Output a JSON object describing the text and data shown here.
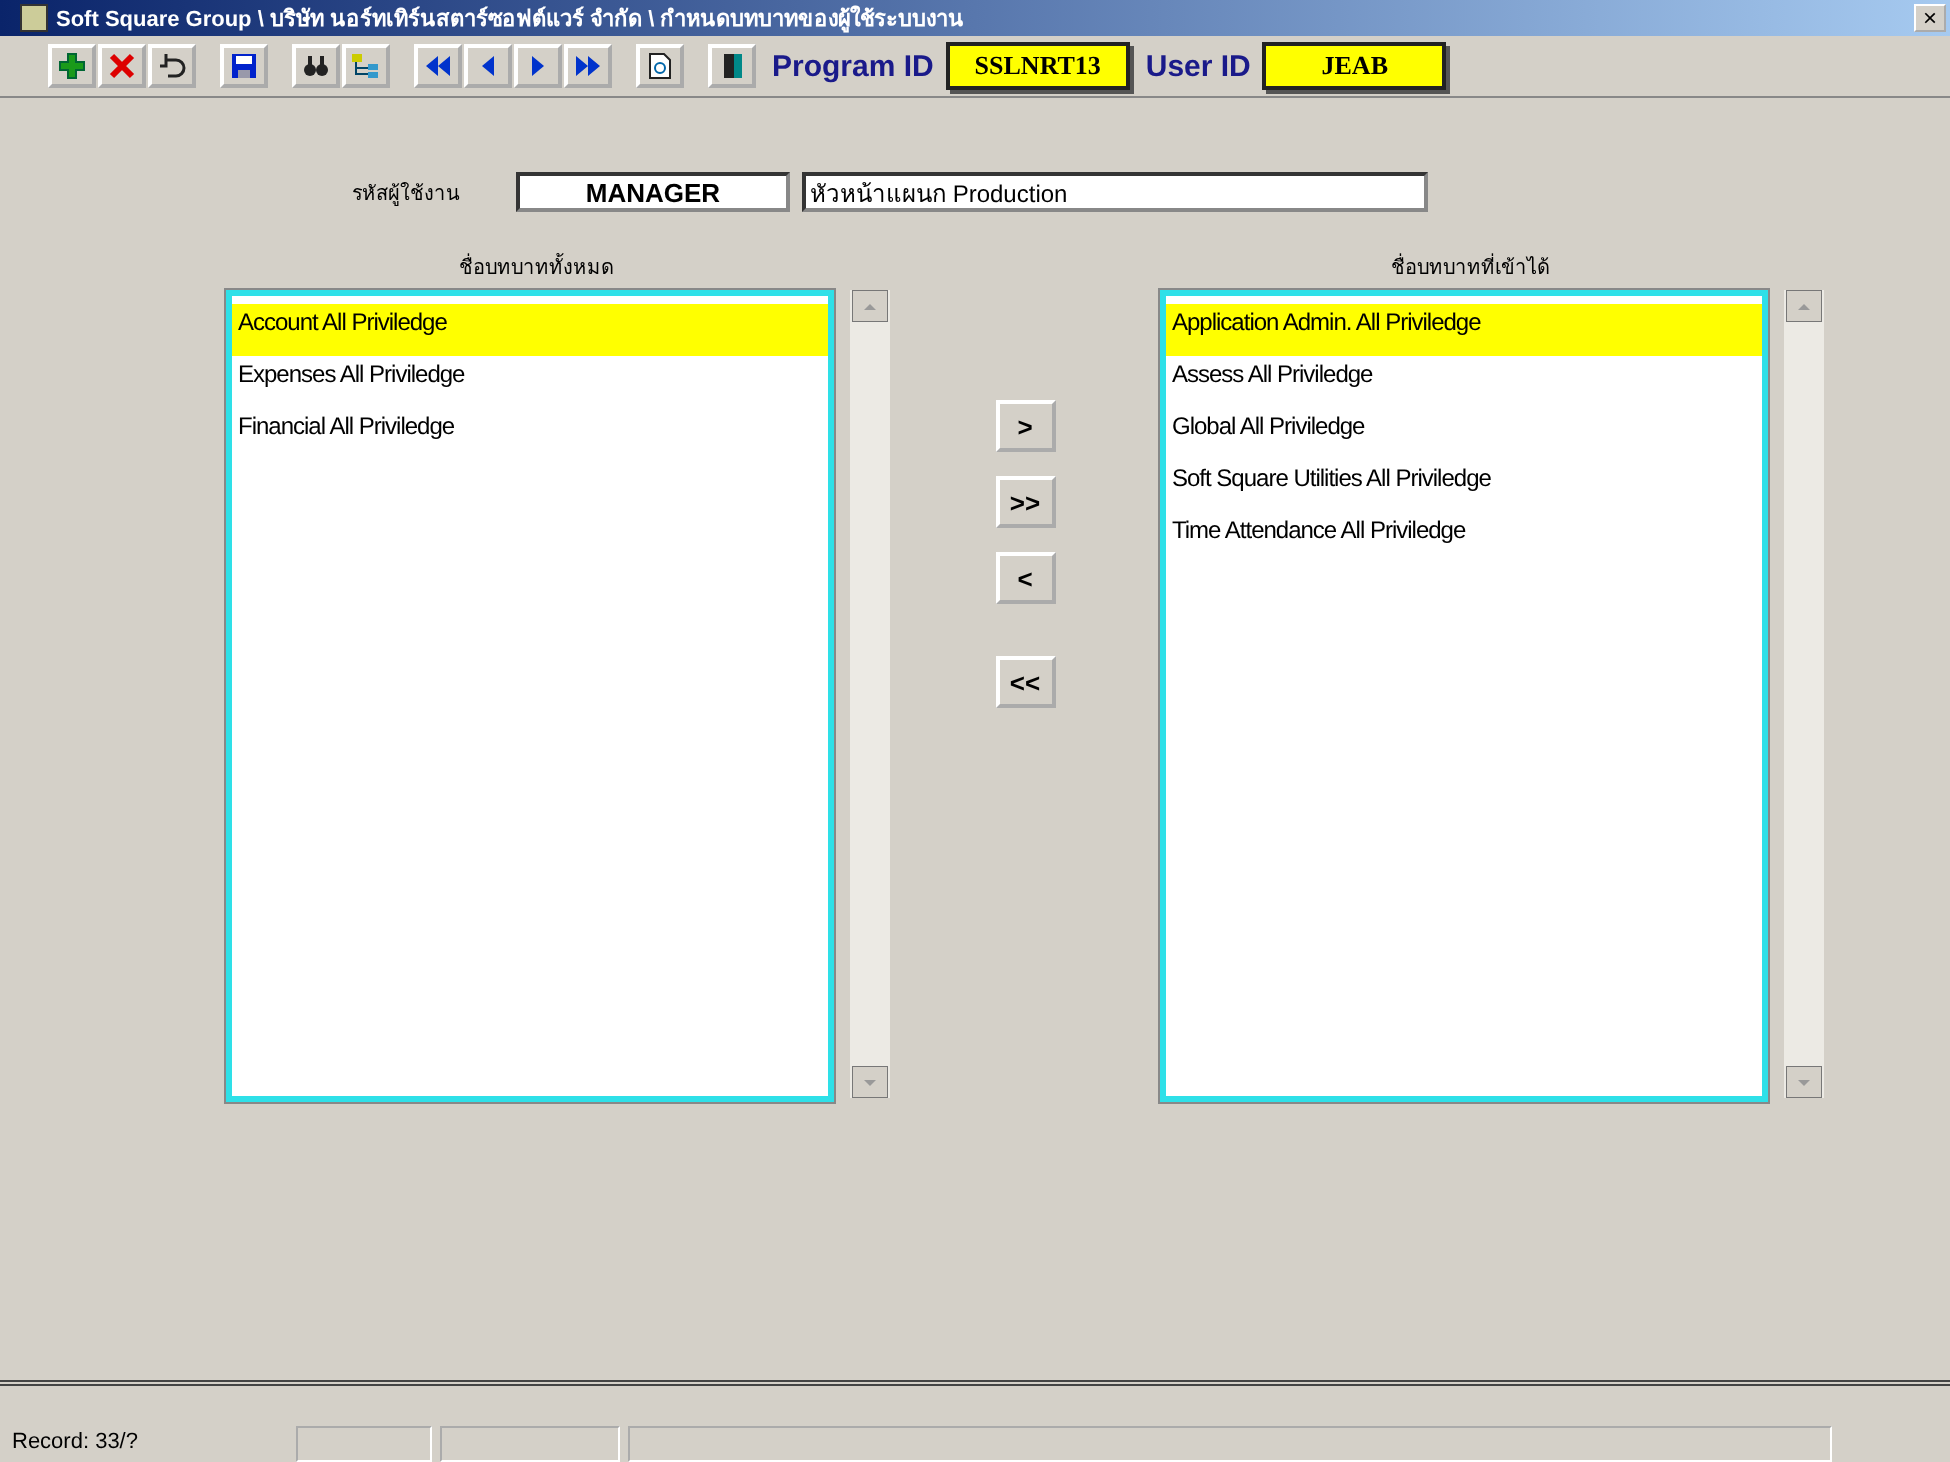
{
  "window": {
    "title": "Soft Square Group \\ บริษัท นอร์ทเทิร์นสตาร์ซอฟต์แวร์ จำกัด \\ กำหนดบทบาทของผู้ใช้ระบบงาน",
    "close": "×"
  },
  "toolbar": {
    "program_id_label": "Program ID",
    "program_id": "SSLNRT13",
    "user_id_label": "User ID",
    "user_id": "JEAB"
  },
  "form": {
    "user_label": "รหัสผู้ใช้งาน",
    "user_code": "MANAGER",
    "user_description": "หัวหน้าแผนก Production"
  },
  "available_roles": {
    "heading": "ชื่อบทบาททั้งหมด",
    "items": [
      {
        "label": "Account All Priviledge",
        "selected": true
      },
      {
        "label": "Expenses All Priviledge",
        "selected": false
      },
      {
        "label": "Financial All Priviledge",
        "selected": false
      }
    ]
  },
  "move_buttons": [
    ">",
    ">>",
    "<",
    "<<"
  ],
  "granted_roles": {
    "heading": "ชื่อบทบาทที่เข้าได้",
    "items": [
      {
        "label": "Application Admin. All Priviledge",
        "selected": true
      },
      {
        "label": "Assess All Priviledge",
        "selected": false
      },
      {
        "label": "Global All Priviledge",
        "selected": false
      },
      {
        "label": "Soft Square Utilities All Priviledge",
        "selected": false
      },
      {
        "label": "Time Attendance All Priviledge",
        "selected": false
      }
    ]
  },
  "status_bar": {
    "record": "Record: 33/?"
  }
}
